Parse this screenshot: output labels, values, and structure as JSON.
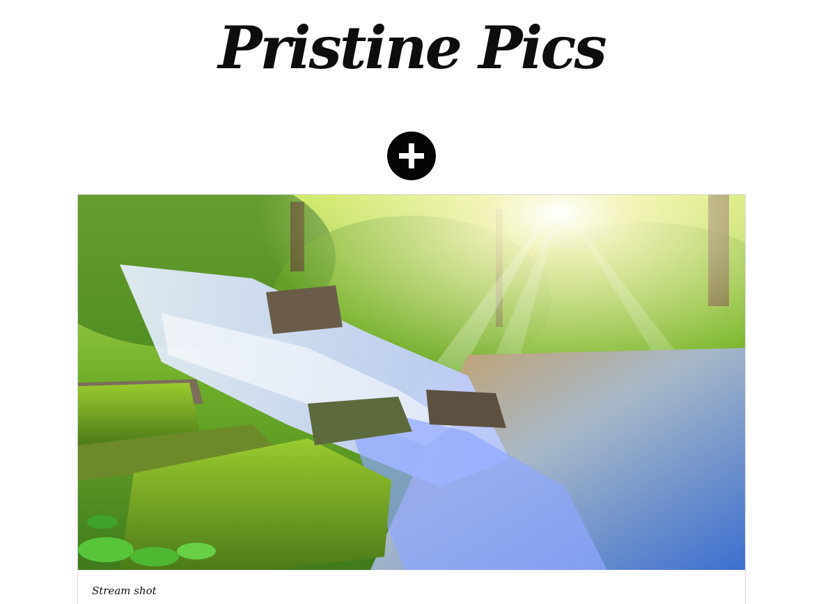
{
  "header": {
    "site_title": "Pristine Pics"
  },
  "toolbar": {
    "add_icon": "plus-icon"
  },
  "gallery": {
    "cards": [
      {
        "caption": "Stream shot",
        "image_subject": "forest waterfall cascading over mossy rocks into a stream with sun rays"
      }
    ]
  },
  "colors": {
    "title": "#0d0d0d",
    "add_button": "#050505",
    "card_border": "#d6d6d6"
  }
}
